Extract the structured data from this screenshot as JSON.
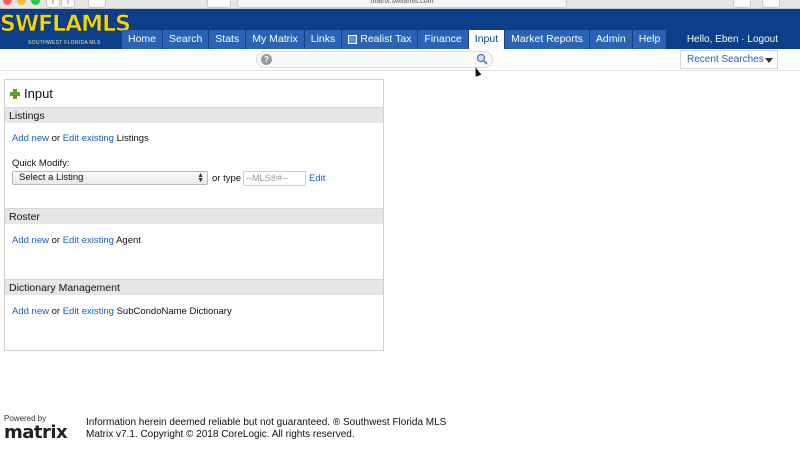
{
  "browser": {
    "address": "matrix.swflamls.com"
  },
  "header": {
    "logo_text": "SWFLAMLS",
    "logo_tagline": "SOUTHWEST FLORIDA MLS",
    "nav": [
      {
        "label": "Home"
      },
      {
        "label": "Search"
      },
      {
        "label": "Stats"
      },
      {
        "label": "My Matrix"
      },
      {
        "label": "Links"
      },
      {
        "label": "Realist Tax"
      },
      {
        "label": "Finance"
      },
      {
        "label": "Input"
      },
      {
        "label": "Market Reports"
      },
      {
        "label": "Admin"
      },
      {
        "label": "Help"
      }
    ],
    "active_nav": "Input",
    "user_links": "Hello, Eben · Logout"
  },
  "search": {
    "help_glyph": "?",
    "recent_searches_label": "Recent Searches"
  },
  "panel": {
    "title": "Input",
    "listings": {
      "heading": "Listings",
      "add_new": "Add new",
      "or": "or",
      "edit_existing": "Edit existing",
      "object": "Listings",
      "quick_modify_label": "Quick Modify:",
      "select_value": "Select a Listing",
      "or_type": "or type",
      "mls_placeholder": "--MLS®#--",
      "edit_label": "Edit"
    },
    "roster": {
      "heading": "Roster",
      "add_new": "Add new",
      "or": "or",
      "edit_existing": "Edit existing",
      "object": "Agent"
    },
    "dictionary": {
      "heading": "Dictionary Management",
      "add_new": "Add new",
      "or": "or",
      "edit_existing": "Edit existing",
      "object": "SubCondoName Dictionary"
    }
  },
  "footer": {
    "powered_by": "Powered by",
    "matrix_logo": "matrix",
    "line1": "Information herein deemed reliable but not guaranteed. ® Southwest Florida MLS",
    "line2": "Matrix v7.1. Copyright © 2018 CoreLogic. All rights reserved."
  },
  "colors": {
    "header_bg": "#0c3f8a",
    "nav_bg": "#2a63b6",
    "link": "#1a5fb4",
    "logo_yellow": "#f5d400",
    "plus_green": "#5aa532"
  }
}
